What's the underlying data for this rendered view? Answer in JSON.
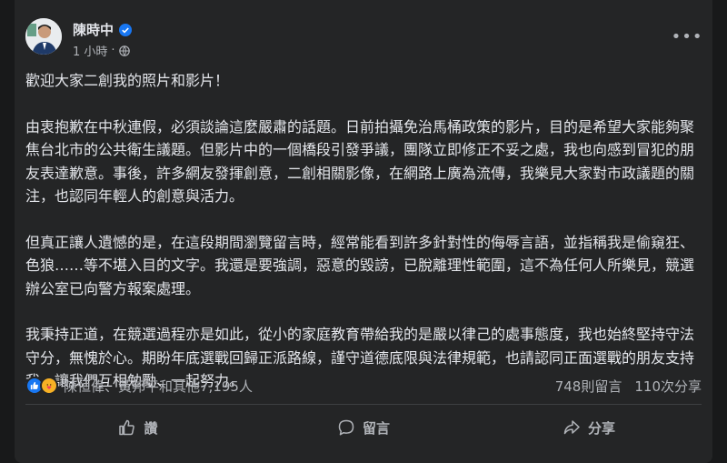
{
  "post": {
    "author": "陳時中",
    "timestamp": "1 小時",
    "privacy_icon": "globe-icon",
    "paragraphs": [
      "歡迎大家二創我的照片和影片！",
      "由衷抱歉在中秋連假，必須談論這麼嚴肅的話題。日前拍攝免治馬桶政策的影片，目的是希望大家能夠聚焦台北市的公共衛生議題。但影片中的一個橋段引發爭議，團隊立即修正不妥之處，我也向感到冒犯的朋友表達歉意。事後，許多網友發揮創意，二創相關影像，在網路上廣為流傳，我樂見大家對市政議題的關注，也認同年輕人的創意與活力。",
      "但真正讓人遺憾的是，在這段期間瀏覽留言時，經常能看到許多針對性的侮辱言語，並指稱我是偷窺狂、色狼……等不堪入目的文字。我還是要強調，惡意的毀謗，已脫離理性範圍，這不為任何人所樂見，競選辦公室已向警方報案處理。",
      "我秉持正道，在競選過程亦是如此，從小的家庭教育帶給我的是嚴以律己的處事態度，我也始終堅持守法守分，無愧於心。期盼年底選戰回歸正派路線，謹守道德底限與法律規範，也請認同正面選戰的朋友支持我，讓我們互相勉勵、一起努力。"
    ]
  },
  "stats": {
    "reactors": "陳恒偉、黃邦平和其他7,195人",
    "comments": "748則留言",
    "shares": "110次分享"
  },
  "actions": {
    "like": "讚",
    "comment": "留言",
    "share": "分享"
  },
  "colors": {
    "background": "#18191a",
    "card": "#242526",
    "accent": "#1877f2"
  }
}
